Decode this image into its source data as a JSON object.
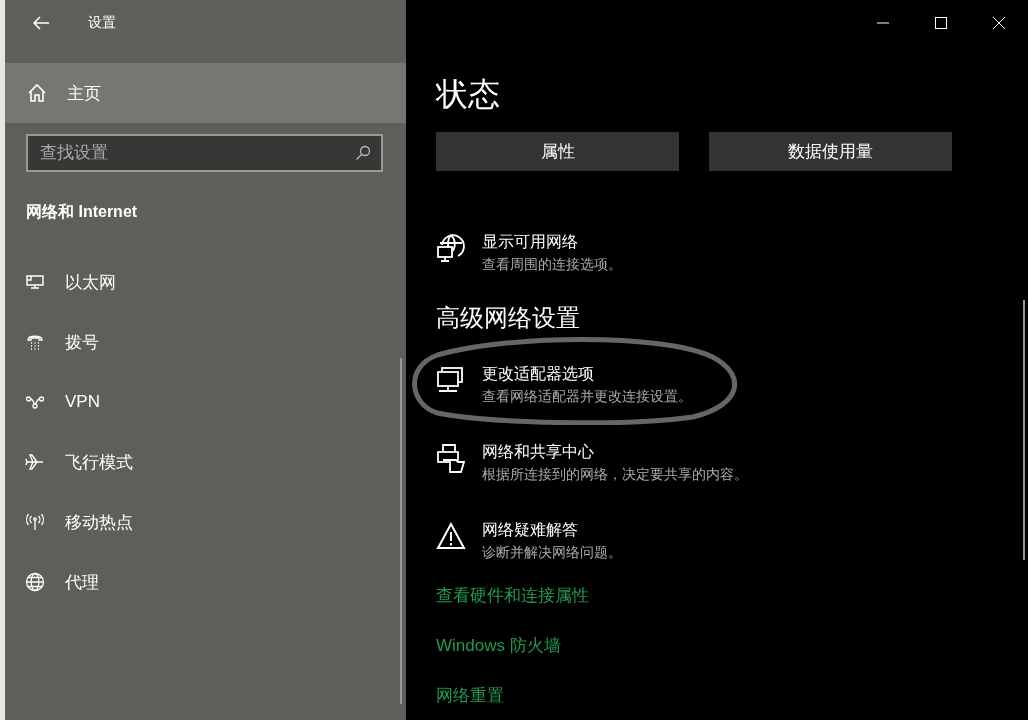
{
  "window": {
    "title": "设置"
  },
  "sidebar": {
    "home": {
      "label": "主页",
      "selected": true
    },
    "search": {
      "placeholder": "查找设置"
    },
    "section": "网络和 Internet",
    "items": [
      {
        "label": "以太网",
        "selected": false
      },
      {
        "label": "拨号",
        "selected": false
      },
      {
        "label": "VPN",
        "selected": false
      },
      {
        "label": "飞行模式",
        "selected": false
      },
      {
        "label": "移动热点",
        "selected": false
      },
      {
        "label": "代理",
        "selected": false
      }
    ]
  },
  "main": {
    "title": "状态",
    "buttons": [
      "属性",
      "数据使用量"
    ],
    "items": [
      {
        "title": "显示可用网络",
        "subtitle": "查看周围的连接选项。",
        "highlighted": false
      }
    ],
    "advanced_heading": "高级网络设置",
    "advanced_items": [
      {
        "title": "更改适配器选项",
        "subtitle": "查看网络适配器并更改连接设置。",
        "highlighted": true
      },
      {
        "title": "网络和共享中心",
        "subtitle": "根据所连接到的网络，决定要共享的内容。",
        "highlighted": false
      },
      {
        "title": "网络疑难解答",
        "subtitle": "诊断并解决网络问题。",
        "highlighted": false
      }
    ],
    "links": [
      "查看硬件和连接属性",
      "Windows 防火墙",
      "网络重置"
    ]
  }
}
